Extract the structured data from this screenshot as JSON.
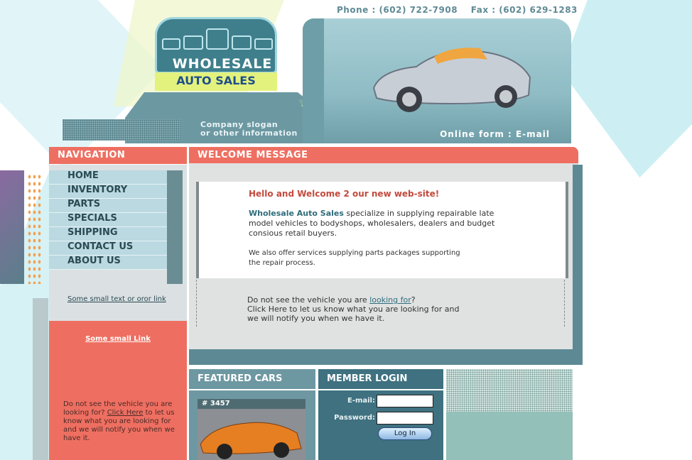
{
  "header": {
    "phone_label": "Phone :",
    "phone": "(602) 722-7908",
    "fax_label": "Fax :",
    "fax": "(602) 629-1283",
    "logo_line1": "WHOLESALE",
    "logo_line2": "AUTO SALES",
    "slogan_line1": "Company slogan",
    "slogan_line2": "or other information",
    "online_form": "Online form",
    "email": "E-mail"
  },
  "colors": {
    "accent": "#ee6f61",
    "teal": "#5d8995",
    "light_blue": "#bad9e1"
  },
  "nav": {
    "title": "NAVIGATION",
    "items": [
      {
        "label": "HOME"
      },
      {
        "label": "INVENTORY"
      },
      {
        "label": "PARTS"
      },
      {
        "label": "SPECIALS"
      },
      {
        "label": "SHIPPING"
      },
      {
        "label": "CONTACT US"
      },
      {
        "label": "ABOUT US"
      }
    ],
    "small_link": "Some small text or oror link"
  },
  "left_promo": {
    "link": "Some small Link",
    "text_pre": "Do not see the vehicle you are looking for?",
    "click_here": "Click Here",
    "text_post": "to let us know what you are looking for and we will notify you when we have it."
  },
  "welcome": {
    "title": "WELCOME MESSAGE",
    "heading": "Hello and Welcome 2 our new web-site!",
    "company": "Wholesale Auto Sales",
    "p1_rest": "specialize in supplying repairable late model vehicles to bodyshops, wholesalers, dealers and budget consious retail buyers.",
    "p2": "We also offer services supplying parts packages supporting the repair process.",
    "lower_pre": "Do not see the vehicle you are",
    "lower_link": "looking for",
    "lower_post": "?",
    "lower_line2": "Click Here to let us know what you are looking for and",
    "lower_line3": "we will notify you when we have it."
  },
  "featured": {
    "title": "FEATURED CARS",
    "car_id": "# 3457"
  },
  "login": {
    "title": "MEMBER LOGIN",
    "email_label": "E-mail:",
    "password_label": "Password:",
    "button": "Log In"
  }
}
